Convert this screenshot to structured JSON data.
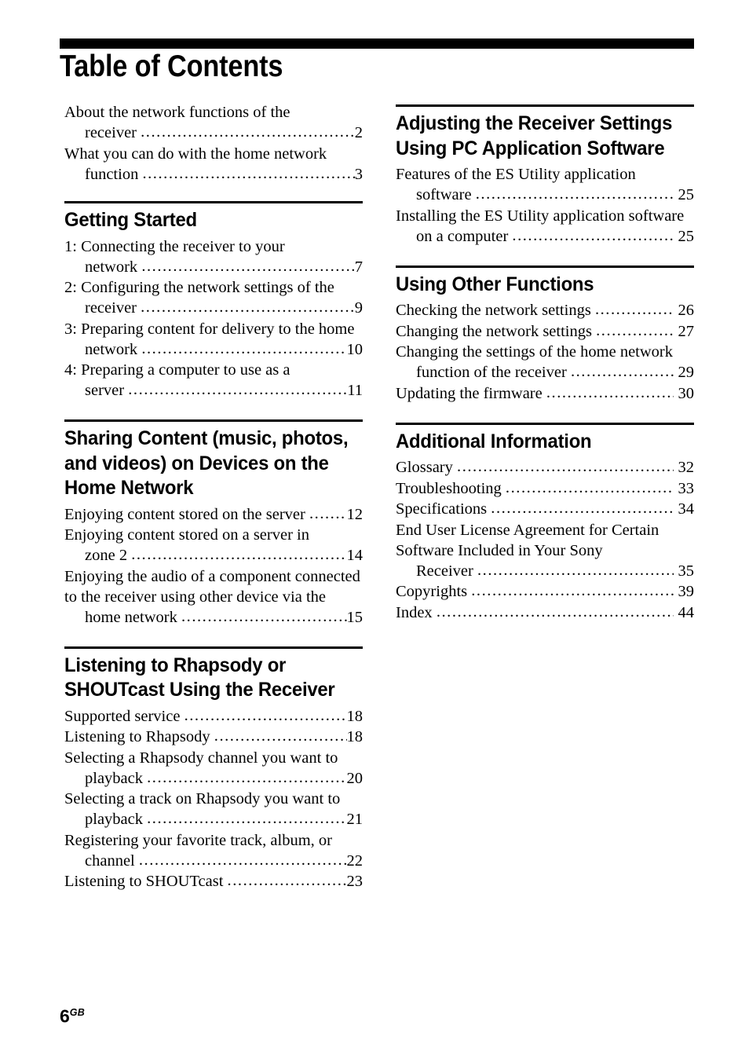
{
  "document": {
    "title": "Table of Contents",
    "folio_number": "6",
    "folio_suffix": "GB"
  },
  "left_column": {
    "intro_entries": [
      {
        "lines": [
          "About the network functions of the"
        ],
        "last_line": "receiver ",
        "page": "2",
        "indent_last": true
      },
      {
        "lines": [
          "What you can do with the home network"
        ],
        "last_line": "function ",
        "page": "3",
        "indent_last": true
      }
    ],
    "sections": [
      {
        "heading": "Getting Started",
        "entries": [
          {
            "lines": [
              "1: Connecting the receiver to your"
            ],
            "last_line": "network ",
            "page": "7",
            "indent_last": true
          },
          {
            "lines": [
              "2: Configuring the network settings of the"
            ],
            "last_line": "receiver ",
            "page": "9",
            "indent_last": true
          },
          {
            "lines": [
              "3: Preparing content for delivery to the home"
            ],
            "last_line": "network ",
            "page": "10",
            "indent_last": true
          },
          {
            "lines": [
              "4: Preparing a computer to use as a"
            ],
            "last_line": "server ",
            "page": "11",
            "indent_last": true
          }
        ]
      },
      {
        "heading": "Sharing Content (music, photos, and videos) on Devices on the Home Network",
        "entries": [
          {
            "lines": [],
            "last_line": "Enjoying content stored on the server ",
            "page": "12",
            "indent_last": false
          },
          {
            "lines": [
              "Enjoying content stored on a server in"
            ],
            "last_line": "zone 2 ",
            "page": "14",
            "indent_last": true
          },
          {
            "lines": [
              "Enjoying the audio of a component connected",
              "to the receiver using other device via the"
            ],
            "last_line": "home network ",
            "page": "15",
            "indent_last": true
          }
        ]
      },
      {
        "heading": "Listening to Rhapsody or SHOUTcast Using the Receiver",
        "entries": [
          {
            "lines": [],
            "last_line": "Supported service ",
            "page": "18",
            "indent_last": false
          },
          {
            "lines": [],
            "last_line": "Listening to Rhapsody ",
            "page": "18",
            "indent_last": false
          },
          {
            "lines": [
              "Selecting a Rhapsody channel you want to"
            ],
            "last_line": "playback ",
            "page": "20",
            "indent_last": true
          },
          {
            "lines": [
              "Selecting a track on Rhapsody you want to"
            ],
            "last_line": "playback ",
            "page": "21",
            "indent_last": true
          },
          {
            "lines": [
              "Registering your favorite track, album, or"
            ],
            "last_line": "channel ",
            "page": "22",
            "indent_last": true
          },
          {
            "lines": [],
            "last_line": "Listening to SHOUTcast ",
            "page": "23",
            "indent_last": false
          }
        ]
      }
    ]
  },
  "right_column": {
    "sections": [
      {
        "heading": "Adjusting the Receiver Settings Using PC Application Software",
        "entries": [
          {
            "lines": [
              "Features of the ES Utility application"
            ],
            "last_line": "software ",
            "page": " 25",
            "indent_last": true
          },
          {
            "lines": [
              "Installing the ES Utility application software"
            ],
            "last_line": "on a computer ",
            "page": " 25",
            "indent_last": true
          }
        ]
      },
      {
        "heading": "Using Other Functions",
        "entries": [
          {
            "lines": [],
            "last_line": "Checking the network settings ",
            "page": " 26",
            "indent_last": false
          },
          {
            "lines": [],
            "last_line": "Changing the network settings ",
            "page": " 27",
            "indent_last": false
          },
          {
            "lines": [
              "Changing the settings of the home network"
            ],
            "last_line": "function of the receiver ",
            "page": " 29",
            "indent_last": true
          },
          {
            "lines": [],
            "last_line": "Updating the firmware ",
            "page": " 30",
            "indent_last": false
          }
        ]
      },
      {
        "heading": "Additional Information",
        "entries": [
          {
            "lines": [],
            "last_line": "Glossary ",
            "page": " 32",
            "indent_last": false
          },
          {
            "lines": [],
            "last_line": "Troubleshooting ",
            "page": " 33",
            "indent_last": false
          },
          {
            "lines": [],
            "last_line": "Specifications ",
            "page": " 34",
            "indent_last": false
          },
          {
            "lines": [
              "End User License Agreement for Certain",
              "Software Included in Your Sony"
            ],
            "last_line": "Receiver ",
            "page": " 35",
            "indent_last": true
          },
          {
            "lines": [],
            "last_line": "Copyrights ",
            "page": " 39",
            "indent_last": false
          },
          {
            "lines": [],
            "last_line": "Index ",
            "page": " 44",
            "indent_last": false
          }
        ]
      }
    ]
  }
}
